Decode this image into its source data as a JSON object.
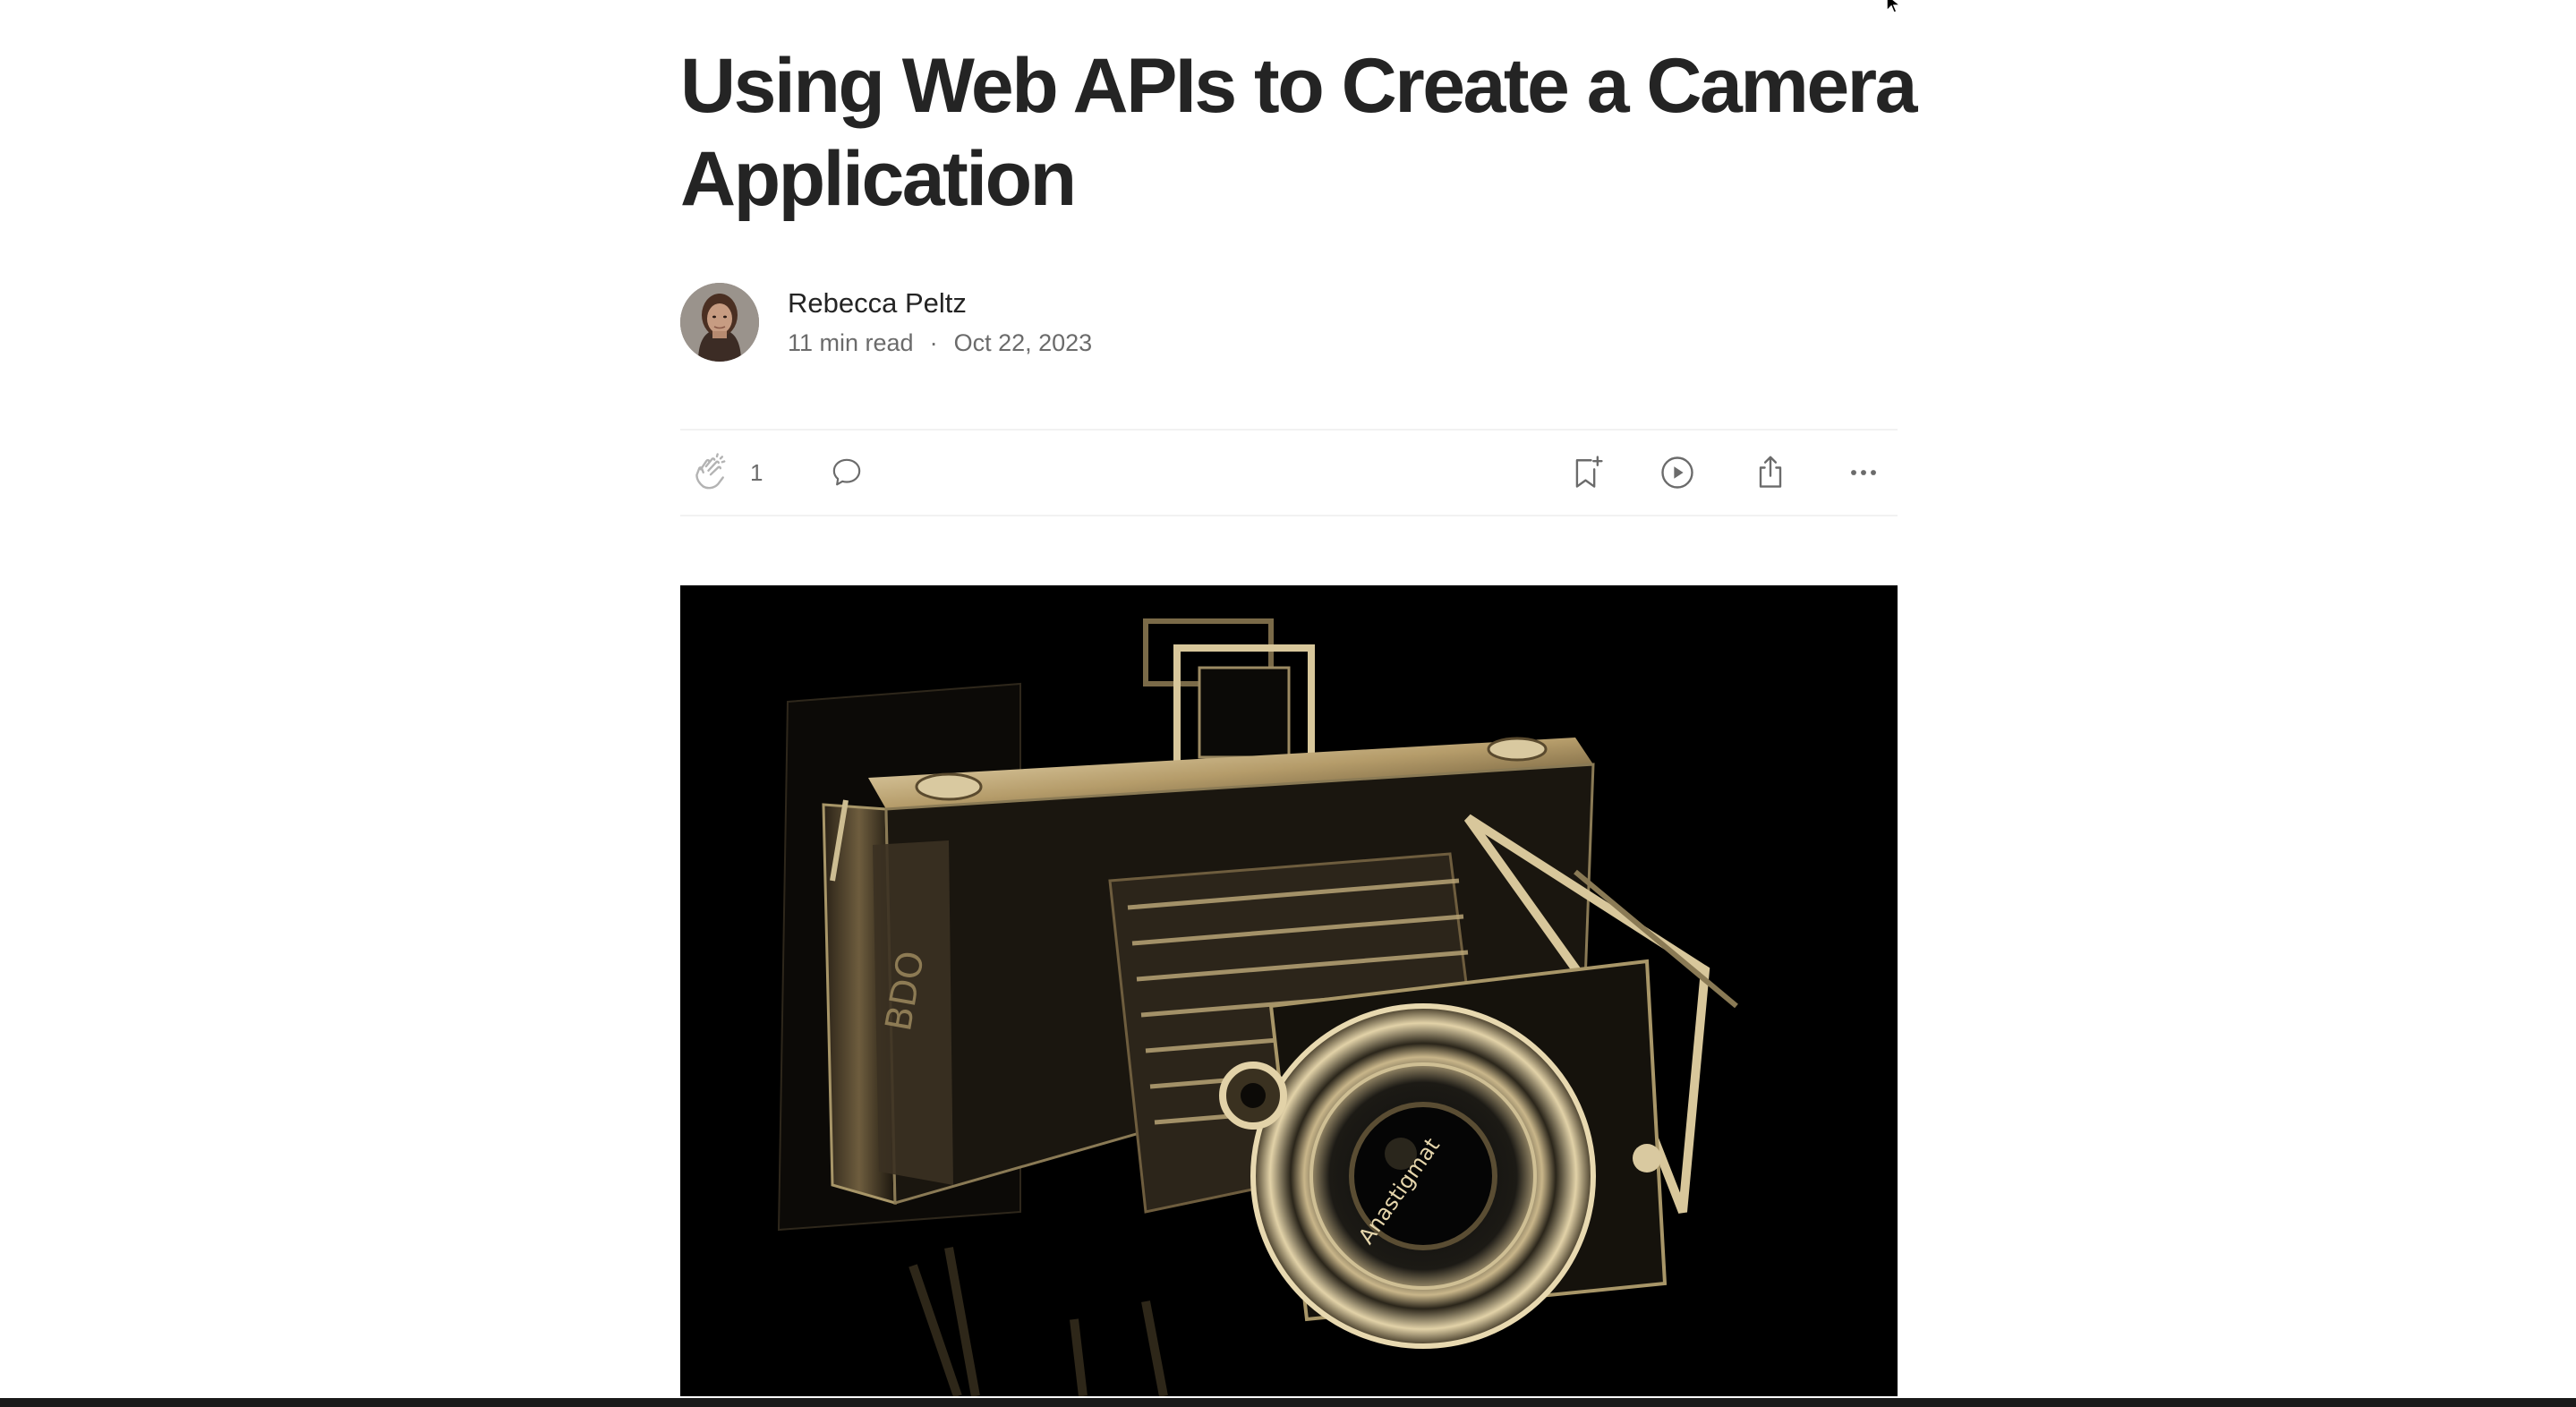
{
  "article": {
    "title": "Using Web APIs to Create a Camera Application",
    "author": "Rebecca Peltz",
    "read_time": "11 min read",
    "separator": "·",
    "date": "Oct 22, 2023"
  },
  "actions": {
    "clap_count": "1",
    "icons": [
      "clap-icon",
      "comment-icon",
      "bookmark-add-icon",
      "play-icon",
      "share-icon",
      "more-icon"
    ]
  },
  "hero_image": {
    "subject": "vintage folding camera on black background",
    "lens_text": "Anastigmat",
    "tint": "#d9c9a0"
  }
}
